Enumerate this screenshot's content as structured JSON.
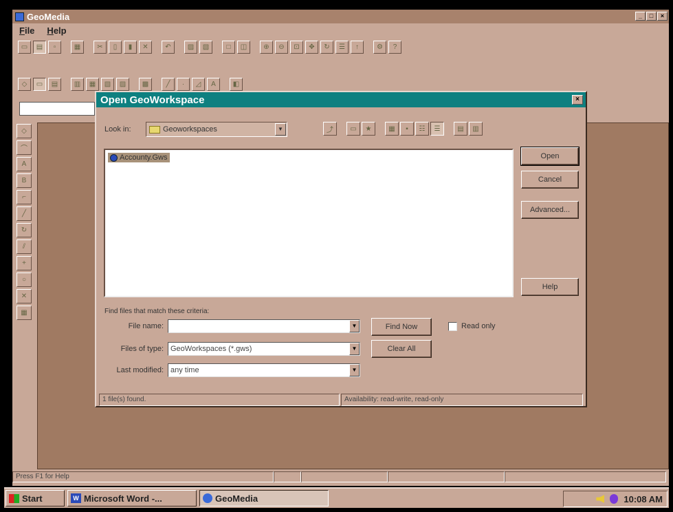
{
  "app": {
    "title": "GeoMedia",
    "window_buttons": [
      "_",
      "□",
      "×"
    ]
  },
  "menu": {
    "items": [
      "File",
      "Help"
    ]
  },
  "main_status": "Press F1 for Help",
  "dialog": {
    "title": "Open GeoWorkspace",
    "close_label": "×",
    "look_in_label": "Look in:",
    "look_in_value": "Geoworkspaces",
    "files": [
      "Accounty.Gws"
    ],
    "buttons": {
      "open": "Open",
      "cancel": "Cancel",
      "advanced": "Advanced...",
      "help": "Help",
      "find_now": "Find Now",
      "clear_all": "Clear All"
    },
    "criteria_label": "Find files that match these criteria:",
    "file_name_label": "File name:",
    "file_name_value": "",
    "files_of_type_label": "Files of type:",
    "files_of_type_value": "GeoWorkspaces (*.gws)",
    "last_modified_label": "Last modified:",
    "last_modified_value": "any time",
    "read_only_label": "Read only",
    "status_found": "1 file(s) found.",
    "status_availability": "Availability: read-write, read-only"
  },
  "taskbar": {
    "start_label": "Start",
    "tasks": [
      "Microsoft Word -...",
      "GeoMedia"
    ],
    "clock": "10:08 AM"
  },
  "colors": {
    "dialog_title_bg": "#0e8080",
    "window_face": "#c8a898",
    "map_area": "#a07a62"
  }
}
